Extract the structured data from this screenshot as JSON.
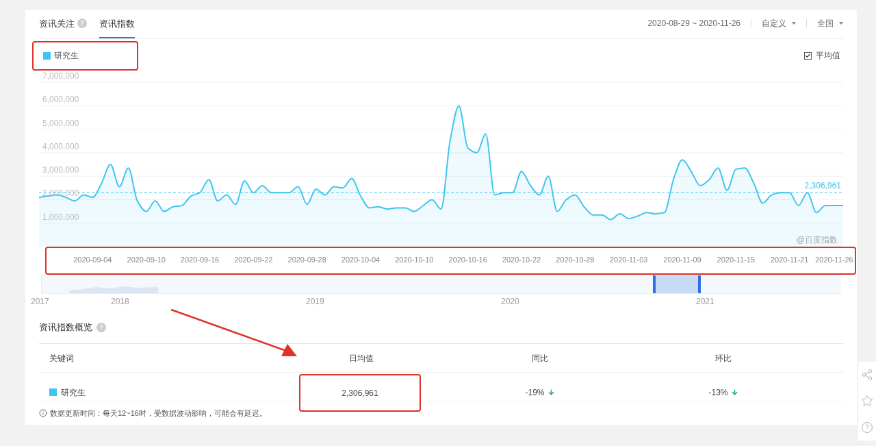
{
  "tabs": [
    {
      "label": "资讯关注",
      "selected": false,
      "help": true
    },
    {
      "label": "资讯指数",
      "selected": true,
      "help": false
    }
  ],
  "date_range": "2020-08-29 ~ 2020-11-26",
  "filters": [
    {
      "label": "自定义"
    },
    {
      "label": "全国"
    }
  ],
  "legend": {
    "highlighted": true
  },
  "average_toggle": {
    "label": "平均值",
    "checked": true
  },
  "chart_data": {
    "type": "line",
    "categories": [
      null,
      null,
      null,
      null,
      null,
      null,
      "2020-09-04",
      null,
      null,
      null,
      null,
      null,
      "2020-09-10",
      null,
      null,
      null,
      null,
      null,
      "2020-09-16",
      null,
      null,
      null,
      null,
      null,
      "2020-09-22",
      null,
      null,
      null,
      null,
      null,
      "2020-09-28",
      null,
      null,
      null,
      null,
      null,
      "2020-10-04",
      null,
      null,
      null,
      null,
      null,
      "2020-10-10",
      null,
      null,
      null,
      null,
      null,
      "2020-10-16",
      null,
      null,
      null,
      null,
      null,
      "2020-10-22",
      null,
      null,
      null,
      null,
      null,
      "2020-10-28",
      null,
      null,
      null,
      null,
      null,
      "2020-11-03",
      null,
      null,
      null,
      null,
      null,
      "2020-11-09",
      null,
      null,
      null,
      null,
      null,
      "2020-11-15",
      null,
      null,
      null,
      null,
      null,
      "2020-11-21",
      null,
      null,
      null,
      null,
      "2020-11-26",
      null
    ],
    "series": [
      {
        "name": "研究生",
        "color": "#3ec6f0",
        "values": [
          2100000,
          2150000,
          2200000,
          2100000,
          1950000,
          2200000,
          2100000,
          2700000,
          3500000,
          2550000,
          3350000,
          1950000,
          1500000,
          1950000,
          1500000,
          1700000,
          1750000,
          2150000,
          2300000,
          2850000,
          1950000,
          2200000,
          1800000,
          2800000,
          2300000,
          2600000,
          2300000,
          2300000,
          2300000,
          2550000,
          1800000,
          2450000,
          2200000,
          2550000,
          2500000,
          2900000,
          2150000,
          1650000,
          1700000,
          1600000,
          1650000,
          1650000,
          1500000,
          1750000,
          2000000,
          1600000,
          4500000,
          6000000,
          4200000,
          4000000,
          4800000,
          2200000,
          2300000,
          2300000,
          3200000,
          2600000,
          2200000,
          3000000,
          1500000,
          2000000,
          2200000,
          1700000,
          1350000,
          1350000,
          1150000,
          1400000,
          1200000,
          1300000,
          1450000,
          1400000,
          1450000,
          2850000,
          3700000,
          3200000,
          2600000,
          2850000,
          3350000,
          2400000,
          3300000,
          3350000,
          2700000,
          1850000,
          2200000,
          2300000,
          2300000,
          1750000,
          2300000,
          1450000,
          1750000,
          1750000,
          1750000
        ]
      }
    ],
    "ylim": [
      0,
      7500000
    ],
    "yticks": [
      {
        "value": 1000000,
        "label": "1,000,000"
      },
      {
        "value": 2000000,
        "label": "2,000,000"
      },
      {
        "value": 3000000,
        "label": "3,000,000"
      },
      {
        "value": 4000000,
        "label": "4,000,000"
      },
      {
        "value": 5000000,
        "label": "5,000,000"
      },
      {
        "value": 6000000,
        "label": "6,000,000"
      },
      {
        "value": 7000000,
        "label": "7,000,000"
      }
    ],
    "grid": true,
    "ref_lines": [
      {
        "axis": "y",
        "value": 2306961,
        "label": "2,306,961"
      }
    ]
  },
  "credit": "@百度指数",
  "axis_highlighted": true,
  "navigator": {
    "years": [
      "2017",
      "2018",
      "2019",
      "2020",
      "2021"
    ]
  },
  "summary": {
    "title": "资讯指数概览",
    "columns": [
      "关键词",
      "日均值",
      "同比",
      "环比"
    ],
    "rows": [
      {
        "keyword": "研究生",
        "color": "#3ec6f0",
        "daily_average": "2,306,961",
        "average_highlighted": true,
        "yoy": {
          "value": "-19%",
          "down": true
        },
        "mom": {
          "value": "-13%",
          "down": true
        }
      }
    ]
  },
  "footnote": "数据更新时间：每天12~16时，受数据波动影响，可能会有延迟。"
}
